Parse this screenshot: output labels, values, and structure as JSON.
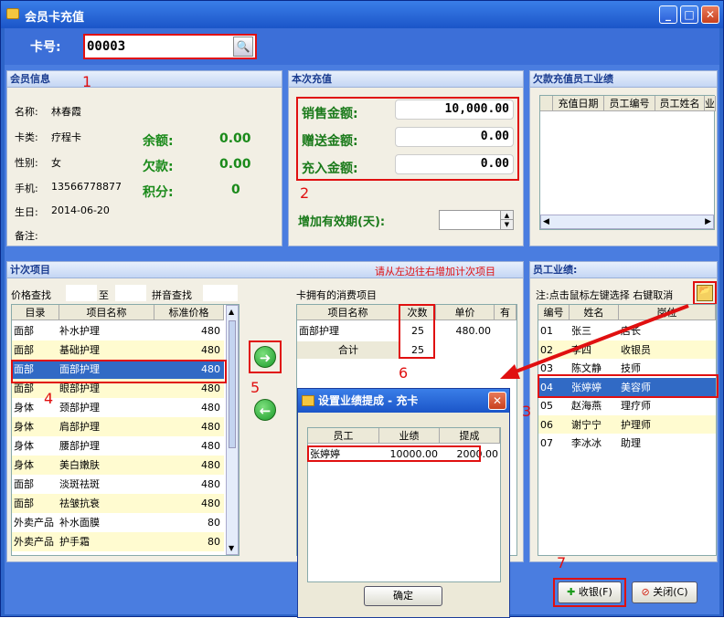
{
  "window": {
    "title": "会员卡充值",
    "minimize": "_",
    "maximize": "□",
    "close": "✕"
  },
  "card": {
    "label": "卡号:",
    "value": "00003"
  },
  "member": {
    "title": "会员信息",
    "name_label": "名称:",
    "name": "林春霞",
    "type_label": "卡类:",
    "type": "疗程卡",
    "gender_label": "性别:",
    "gender": "女",
    "phone_label": "手机:",
    "phone": "13566778877",
    "birth_label": "生日:",
    "birth": "2014-06-20",
    "note_label": "备注:",
    "balance_label": "余额:",
    "balance": "0.00",
    "debt_label": "欠款:",
    "debt": "0.00",
    "points_label": "积分:",
    "points": "0"
  },
  "recharge": {
    "title": "本次充值",
    "sale_label": "销售金额:",
    "sale": "10,000.00",
    "gift_label": "赠送金额:",
    "gift": "0.00",
    "charge_label": "充入金额:",
    "charge": "0.00",
    "validity_label": "增加有效期(天):",
    "validity": ""
  },
  "debtstaff": {
    "title": "欠款充值员工业绩",
    "cols": [
      "充值日期",
      "员工编号",
      "员工姓名",
      "业"
    ]
  },
  "items": {
    "title": "计次项目",
    "hint": "请从左边往右增加计次项目",
    "price_search": "价格查找",
    "to": "至",
    "pinyin": "拼音查找",
    "cols": [
      "目录",
      "项目名称",
      "标准价格"
    ],
    "rows": [
      [
        "面部",
        "补水护理",
        "480"
      ],
      [
        "面部",
        "基础护理",
        "480"
      ],
      [
        "面部",
        "面部护理",
        "480"
      ],
      [
        "面部",
        "眼部护理",
        "480"
      ],
      [
        "身体",
        "颈部护理",
        "480"
      ],
      [
        "身体",
        "肩部护理",
        "480"
      ],
      [
        "身体",
        "腰部护理",
        "480"
      ],
      [
        "身体",
        "美白嫩肤",
        "480"
      ],
      [
        "面部",
        "淡斑祛斑",
        "480"
      ],
      [
        "面部",
        "祛皱抗衰",
        "480"
      ],
      [
        "外卖产品",
        "补水面膜",
        "80"
      ],
      [
        "外卖产品",
        "护手霜",
        "80"
      ]
    ]
  },
  "owned": {
    "title": "卡拥有的消费项目",
    "cols": [
      "项目名称",
      "次数",
      "单价",
      "有"
    ],
    "row": [
      "面部护理",
      "25",
      "480.00"
    ],
    "total_label": "合计",
    "total": "25"
  },
  "staff": {
    "title": "员工业绩:",
    "hint": "注:点击鼠标左键选择 右键取消",
    "cols": [
      "编号",
      "姓名",
      "岗位"
    ],
    "rows": [
      [
        "01",
        "张三",
        "店长"
      ],
      [
        "02",
        "李四",
        "收银员"
      ],
      [
        "03",
        "陈文静",
        "技师"
      ],
      [
        "04",
        "张婷婷",
        "美容师"
      ],
      [
        "05",
        "赵海燕",
        "理疗师"
      ],
      [
        "06",
        "谢宁宁",
        "护理师"
      ],
      [
        "07",
        "李冰冰",
        "助理"
      ]
    ]
  },
  "dialog": {
    "title": "设置业绩提成 - 充卡",
    "cols": [
      "员工",
      "业绩",
      "提成"
    ],
    "row": [
      "张婷婷",
      "10000.00",
      "2000.00"
    ],
    "ok": "确定"
  },
  "buttons": {
    "cashier": "收银(F)",
    "close": "关闭(C)"
  },
  "annotations": [
    "1",
    "2",
    "3",
    "4",
    "5",
    "6",
    "7"
  ]
}
